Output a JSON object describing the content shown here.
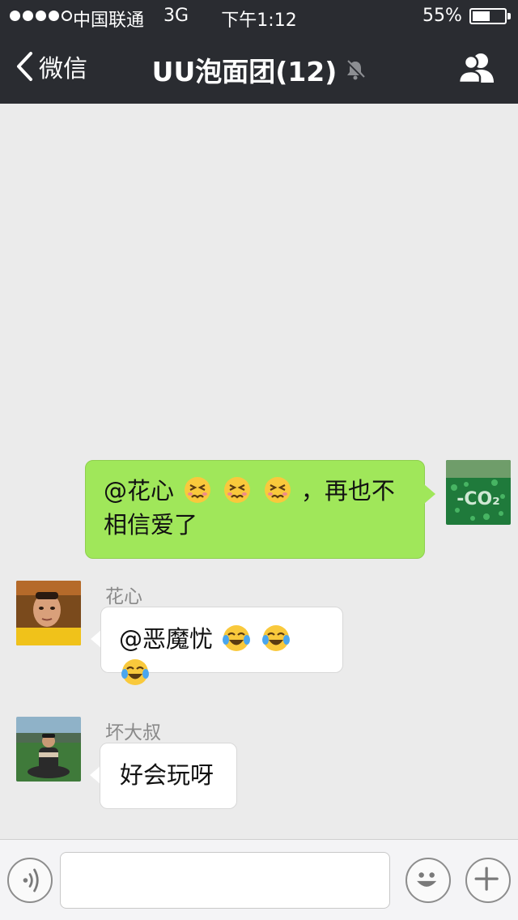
{
  "status_bar": {
    "signal_dots": "●●●●○",
    "carrier": "中国联通",
    "network": "3G",
    "time": "下午1:12",
    "battery_percent": "55%",
    "battery_level": 0.55
  },
  "nav": {
    "back_label": "微信",
    "title": "UU泡面团(12)",
    "icons": {
      "back": "chevron-left-icon",
      "mute": "bell-muted-icon",
      "members": "group-members-icon"
    }
  },
  "messages": [
    {
      "direction": "out",
      "text_before": "@花心",
      "emoji": [
        "persevering-face",
        "persevering-face",
        "persevering-face"
      ],
      "text_after": "，再也不相信爱了",
      "avatar": "co2-green-avatar"
    },
    {
      "direction": "in",
      "sender": "花心",
      "text_before": "@恶魔忧",
      "emoji": [
        "tears-of-joy",
        "tears-of-joy",
        "tears-of-joy"
      ],
      "avatar": "man-yellow-shirt-avatar"
    },
    {
      "direction": "in",
      "sender": "坏大叔",
      "text": "好会玩呀",
      "avatar": "man-sitting-field-avatar"
    }
  ],
  "input_bar": {
    "value": "",
    "icons": {
      "voice": "voice-icon",
      "emoji": "smiley-icon",
      "more": "plus-icon"
    }
  },
  "colors": {
    "nav_bg": "#2a2c31",
    "chat_bg": "#ebebeb",
    "out_bubble": "#a0e75a",
    "in_bubble": "#ffffff"
  }
}
